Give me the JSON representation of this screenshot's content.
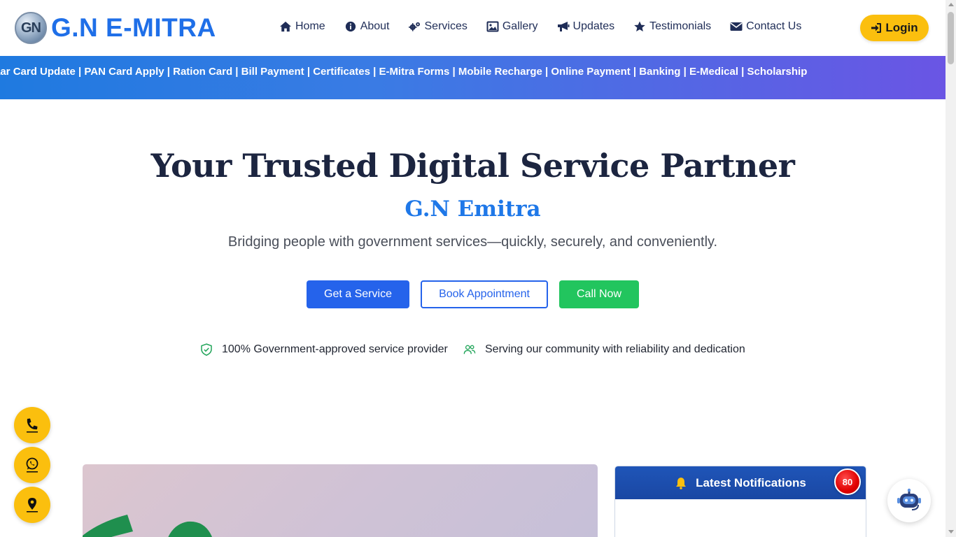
{
  "brand": {
    "badge_text": "GN",
    "name": "G.N E-MITRA"
  },
  "nav": {
    "items": [
      {
        "label": "Home",
        "icon": "home-icon"
      },
      {
        "label": "About",
        "icon": "info-icon"
      },
      {
        "label": "Services",
        "icon": "gears-icon"
      },
      {
        "label": "Gallery",
        "icon": "image-icon"
      },
      {
        "label": "Updates",
        "icon": "megaphone-icon"
      },
      {
        "label": "Testimonials",
        "icon": "star-icon"
      },
      {
        "label": "Contact Us",
        "icon": "envelope-icon"
      }
    ],
    "login_label": "Login"
  },
  "ticker": {
    "text": "aar Card Update | PAN Card Apply | Ration Card | Bill Payment | Certificates | E-Mitra Forms | Mobile Recharge | Online Payment | Banking | E-Medical | Scholarship"
  },
  "hero": {
    "title": "Your Trusted Digital Service Partner",
    "subtitle": "G.N Emitra",
    "description": "Bridging people with government services—quickly, securely, and conveniently.",
    "buttons": {
      "get_service": "Get a Service",
      "book_appointment": "Book Appointment",
      "call_now": "Call Now"
    },
    "features": [
      "100% Government-approved service provider",
      "Serving our community with reliability and dedication"
    ]
  },
  "notifications": {
    "title": "Latest Notifications",
    "count": "80"
  },
  "colors": {
    "brand_blue": "#1f6fe8",
    "accent_yellow": "#fbbf0e",
    "primary_button": "#2563eb",
    "success_green": "#22c55e",
    "notification_red": "#e00000"
  }
}
